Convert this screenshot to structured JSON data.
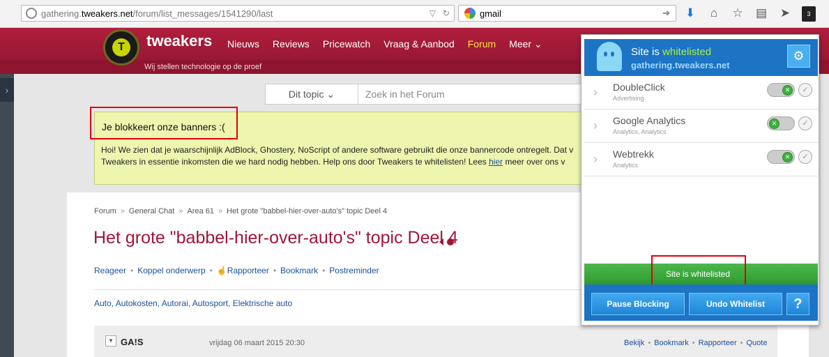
{
  "browser": {
    "url_prefix": "gathering.",
    "url_domain": "tweakers.net",
    "url_path": "/forum/list_messages/1541290/last",
    "search_value": "gmail",
    "ghostery_badge": "3"
  },
  "site": {
    "logo_letter": "T",
    "logo_text": "tweakers",
    "tagline": "Wij stellen technologie op de proef",
    "nav": [
      "Nieuws",
      "Reviews",
      "Pricewatch",
      "Vraag & Aanbod",
      "Forum",
      "Meer ⌄"
    ],
    "topic_select": "Dit topic ⌄",
    "search_placeholder": "Zoek in het Forum"
  },
  "notice": {
    "title": "Je blokkeert onze banners :(",
    "line1": "Hoi! We zien dat je waarschijnlijk AdBlock, Ghostery, NoScript of andere software gebruikt die onze bannercode ontregelt. Dat v",
    "line2_pre": "Tweakers in essentie inkomsten die we hard nodig hebben. Help ons door Tweakers te whitelisten! Lees ",
    "line2_link": "hier",
    "line2_post": " meer over ons v"
  },
  "thread": {
    "crumbs": [
      "Forum",
      "General Chat",
      "Area 61",
      "Het grote \"babbel-hier-over-auto's\" topic Deel 4"
    ],
    "crumb_sep": "»",
    "title": "Het grote \"babbel-hier-over-auto's\" topic Deel 4",
    "actions": [
      "Reageer",
      "Koppel onderwerp",
      "Rapporteer",
      "Bookmark",
      "Postreminder"
    ],
    "tags": "Auto, Autokosten, Autorai, Autosport, Elektrische auto"
  },
  "post": {
    "author": "GA!S",
    "date": "vrijdag 06 maart 2015 20:30",
    "links": [
      "Bekijk",
      "Bookmark",
      "Rapporteer",
      "Quote"
    ]
  },
  "ghostery": {
    "status_pre": "Site is ",
    "status_word": "whitelisted",
    "domain": "gathering.tweakers.net",
    "trackers": [
      {
        "name": "DoubleClick",
        "category": "Advertising"
      },
      {
        "name": "Google Analytics",
        "category": "Analytics, Analytics"
      },
      {
        "name": "Webtrekk",
        "category": "Analytics"
      }
    ],
    "green_label": "Site is whitelisted",
    "pause_button": "Pause Blocking",
    "undo_button": "Undo Whitelist",
    "help_button": "?"
  },
  "colors": {
    "brand_red": "#a1153a",
    "forum_active": "#f3e53a",
    "ghostery_blue": "#1d73c4",
    "whitelist_green": "#a6ef4a",
    "highlight_box": "#e0000b"
  }
}
